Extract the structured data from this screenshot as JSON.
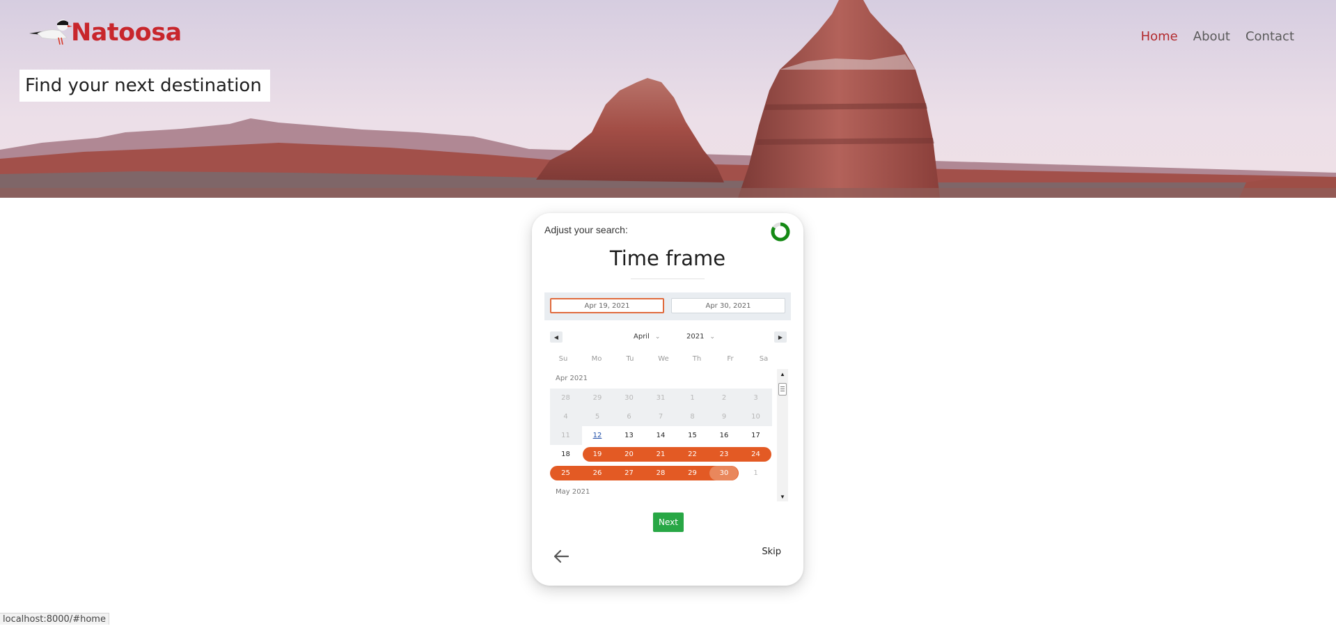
{
  "brand": {
    "name": "Natoosa",
    "color": "#c8262c"
  },
  "nav": {
    "items": [
      {
        "label": "Home",
        "active": true
      },
      {
        "label": "About",
        "active": false
      },
      {
        "label": "Contact",
        "active": false
      }
    ]
  },
  "hero": {
    "tagline": "Find your next destination"
  },
  "card": {
    "subtitle": "Adjust your search:",
    "title": "Time frame",
    "progress_icon": "donut-progress-icon",
    "start_date": "Apr 19, 2021",
    "end_date": "Apr 30, 2021",
    "month_select": "April",
    "year_select": "2021",
    "weekdays": [
      "Su",
      "Mo",
      "Tu",
      "We",
      "Th",
      "Fr",
      "Sa"
    ],
    "month_labels": [
      "Apr 2021",
      "May 2021"
    ],
    "weeks": [
      [
        "28",
        "29",
        "30",
        "31",
        "1",
        "2",
        "3"
      ],
      [
        "4",
        "5",
        "6",
        "7",
        "8",
        "9",
        "10"
      ],
      [
        "11",
        "12",
        "13",
        "14",
        "15",
        "16",
        "17"
      ],
      [
        "18",
        "19",
        "20",
        "21",
        "22",
        "23",
        "24"
      ],
      [
        "25",
        "26",
        "27",
        "28",
        "29",
        "30",
        "1"
      ]
    ],
    "next_label": "Next",
    "skip_label": "Skip",
    "accent_color": "#e35a24",
    "next_color": "#28a745"
  },
  "status_bar": {
    "url": "localhost:8000/#home"
  }
}
